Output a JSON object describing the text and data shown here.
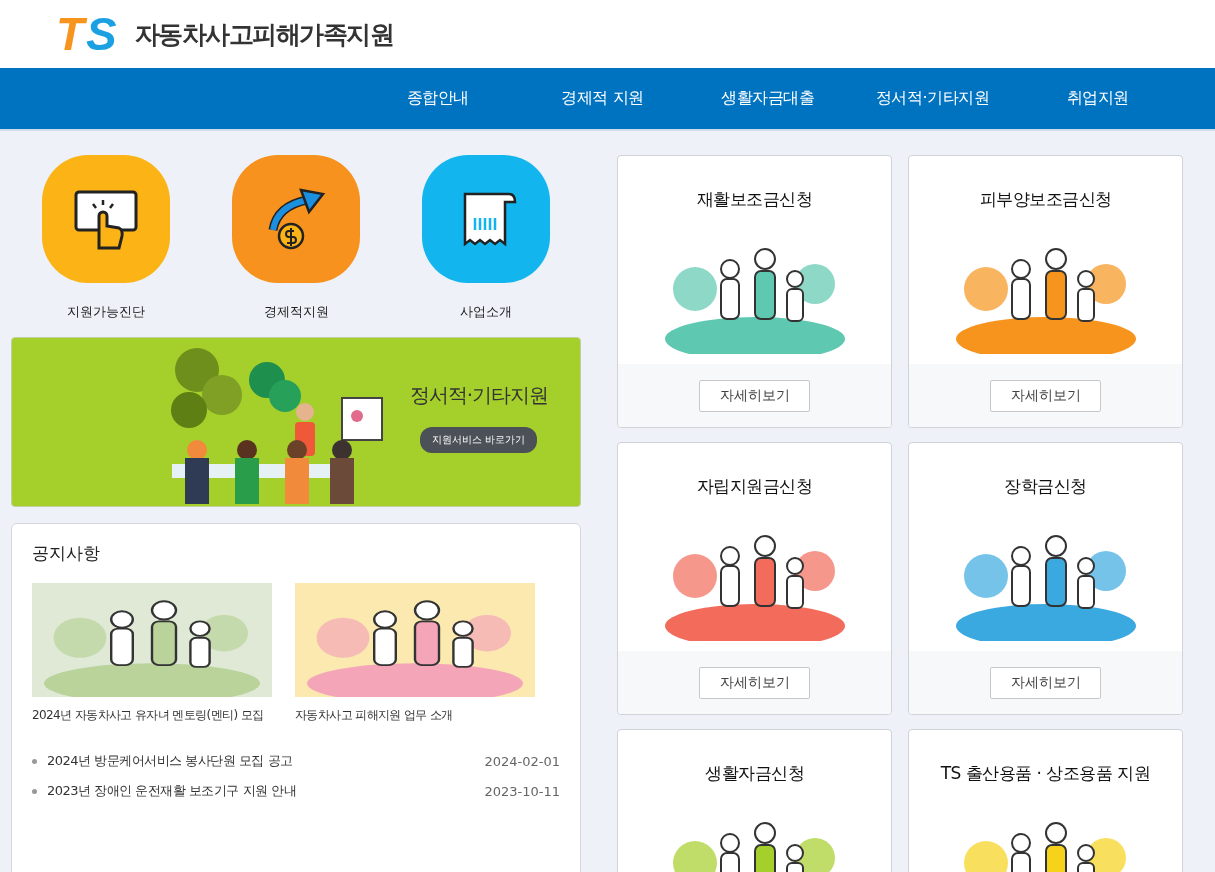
{
  "header": {
    "logo": [
      {
        "char": "T",
        "color": "#f7941d"
      },
      {
        "char": "S",
        "color": "#1ba1e2"
      }
    ],
    "title": "자동차사고피해가족지원"
  },
  "nav": [
    "종합안내",
    "경제적 지원",
    "생활자금대출",
    "정서적·기타지원",
    "취업지원"
  ],
  "quick_links": [
    {
      "label": "지원가능진단",
      "color": "#fbb316",
      "kind": "touch"
    },
    {
      "label": "경제적지원",
      "color": "#f7921e",
      "kind": "money"
    },
    {
      "label": "사업소개",
      "color": "#12b5ee",
      "kind": "receipt"
    }
  ],
  "banner": {
    "title": "정서적·기타지원",
    "button": "지원서비스 바로가기"
  },
  "notices": {
    "title": "공지사항",
    "featured": [
      {
        "caption": "2024년 자동차사고 유자녀 멘토링(멘티) 모집",
        "kind": "picture"
      },
      {
        "caption": "자동차사고 피해지원 업무 소개",
        "kind": "picture"
      }
    ],
    "items": [
      {
        "title": "2024년 방문케어서비스 봉사단원 모집 공고",
        "date": "2024-02-01"
      },
      {
        "title": "2023년 장애인 운전재활 보조기구 지원 안내",
        "date": "2023-10-11"
      }
    ]
  },
  "cards": [
    {
      "title": "재활보조금신청",
      "color": "#5ec8b0",
      "button": "자세히보기"
    },
    {
      "title": "피부양보조금신청",
      "color": "#f7941d",
      "button": "자세히보기"
    },
    {
      "title": "자립지원금신청",
      "color": "#f26b5b",
      "button": "자세히보기"
    },
    {
      "title": "장학금신청",
      "color": "#3aa9e0",
      "button": "자세히보기"
    },
    {
      "title": "생활자금신청",
      "color": "#a5cf2b"
    },
    {
      "title": "TS 출산용품 · 상조용품 지원",
      "color": "#f6d21a"
    }
  ]
}
